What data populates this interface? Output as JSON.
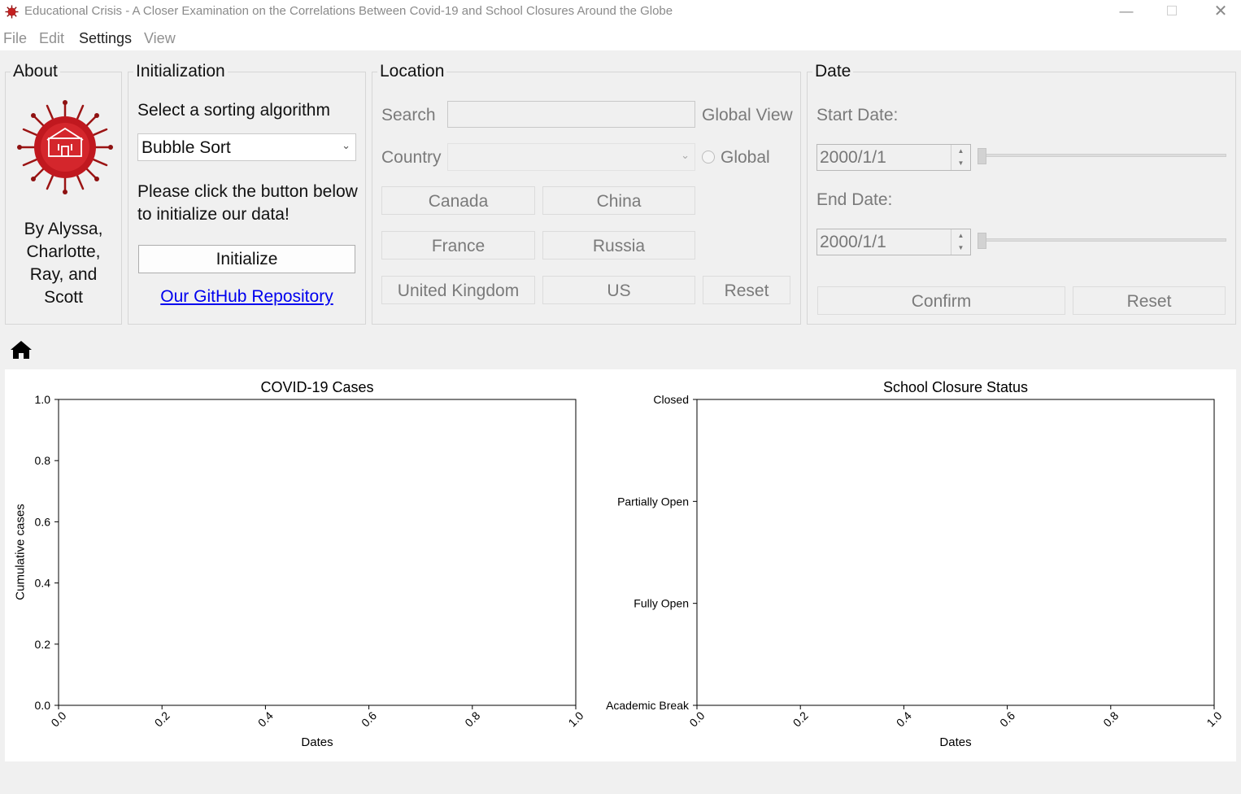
{
  "window": {
    "title": "Educational Crisis - A Closer Examination on the Correlations Between Covid-19 and School Closures Around the Globe"
  },
  "menu": [
    "File",
    "Edit",
    "Settings",
    "View"
  ],
  "about": {
    "legend": "About",
    "authors": [
      "By Alyssa,",
      "Charlotte,",
      "Ray, and",
      "Scott"
    ]
  },
  "init": {
    "legend": "Initialization",
    "prompt": "Select a sorting algorithm",
    "selected": "Bubble Sort",
    "instruction_line1": "Please click the button below",
    "instruction_line2": "to initialize our data!",
    "button": "Initialize",
    "link": "Our GitHub Repository "
  },
  "location": {
    "legend": "Location",
    "search_label": "Search",
    "search_value": "",
    "global_view_label": "Global View",
    "country_label": "Country",
    "country_value": "",
    "global_radio": "Global",
    "buttons": [
      "Canada",
      "China",
      "France",
      "Russia",
      "United Kingdom",
      "US",
      "Reset"
    ]
  },
  "date": {
    "legend": "Date",
    "start_label": "Start Date:",
    "start_value": "2000/1/1",
    "end_label": "End Date:",
    "end_value": "2000/1/1",
    "confirm": "Confirm",
    "reset": "Reset",
    "start_slider": 0,
    "end_slider": 0
  },
  "toolbar": {
    "home_icon": "home-icon"
  },
  "chart_data": [
    {
      "type": "line",
      "title": "COVID-19 Cases",
      "xlabel": "Dates",
      "ylabel": "Cumulative cases",
      "xlim": [
        0,
        1
      ],
      "ylim": [
        0,
        1
      ],
      "xticks": [
        "0.0",
        "0.2",
        "0.4",
        "0.6",
        "0.8",
        "1.0"
      ],
      "yticks": [
        "0.0",
        "0.2",
        "0.4",
        "0.6",
        "0.8",
        "1.0"
      ],
      "series": []
    },
    {
      "type": "line",
      "title": "School Closure Status",
      "xlabel": "Dates",
      "ylabel": "",
      "xlim": [
        0,
        1
      ],
      "xticks": [
        "0.0",
        "0.2",
        "0.4",
        "0.6",
        "0.8",
        "1.0"
      ],
      "yticks": [
        "Academic Break",
        "Fully Open",
        "Partially Open",
        "Closed"
      ],
      "series": []
    }
  ]
}
